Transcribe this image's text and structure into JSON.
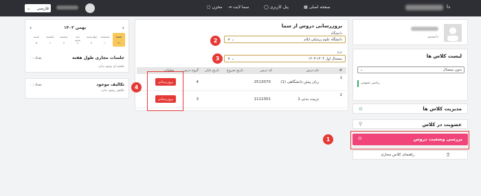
{
  "topbar": {
    "language": "فارسی",
    "nav": [
      {
        "label": "صفحه اصلی",
        "icon": "grid-icon"
      },
      {
        "label": "پنل کاربری",
        "icon": "user-icon"
      },
      {
        "label": "سما لایت",
        "icon": "logout-icon"
      },
      {
        "label": "مخزن",
        "icon": "folder-icon"
      }
    ],
    "brand_suffix": "دا"
  },
  "profile": {
    "role": "دانشجو",
    "class_list_title": "لیست کلاس ها",
    "semester_select": "بدون نیمسال",
    "class_item": "ریاضی عمومی"
  },
  "menu": {
    "manage_classes": "مدیریت کلاس ها",
    "class_membership": "عضویت در کلاس",
    "check_course_status": "بررسی وضعیت دروس",
    "virtual_class_guide": "راهنمای کلاس مجازی"
  },
  "update_panel": {
    "title": "بروزرسانی دروس از سما",
    "university_label": "دانشگاه",
    "university_value": "دانشگاه علوم پزشکی ایلام",
    "term_label": "ترم",
    "term_value": "نیمسال اول ۱۴۰۴-۱۴۰۳",
    "table": {
      "headers": [
        "#",
        "نام درس",
        "کد درس",
        "تاریخ شروع",
        "تاریخ پایان",
        "گروه درس",
        "عملیات"
      ],
      "rows": [
        {
          "num": "1",
          "name": "زبان پیش دانشگاهی (1)",
          "code": "2513070",
          "group": "4",
          "action": "بروزرسانی"
        },
        {
          "num": "2",
          "name": "تربیت بدنی 1",
          "code": "1111001",
          "group": "3",
          "action": "بروزرسانی"
        }
      ]
    }
  },
  "calendar": {
    "month": "بهمن ۱۴۰۳",
    "days": [
      "جمعه",
      "پنجشنبه",
      "چهارشنبه",
      "سه شنبه",
      "دوشنبه",
      "یکشنبه",
      "شنبه"
    ],
    "dates": [
      "۱۱",
      "۱۰",
      "۹",
      "۸",
      "۷",
      "۶",
      "۵"
    ],
    "weekly_sessions_title": "جلسات مجازی طول هفته",
    "weekly_sessions_count": "تعداد : ۰",
    "weekly_sessions_empty": "جلسه ای وجود ندارد",
    "assignments_title": "تکالیف موجود",
    "assignments_count": "تعداد : ۰",
    "assignments_empty": "تکلیفی وجود ندارد"
  },
  "callouts": [
    "1",
    "2",
    "3",
    "4"
  ],
  "colors": {
    "accent": "#e53935",
    "topbar": "#2e2f35",
    "highlight_menu": "#f0447a"
  }
}
